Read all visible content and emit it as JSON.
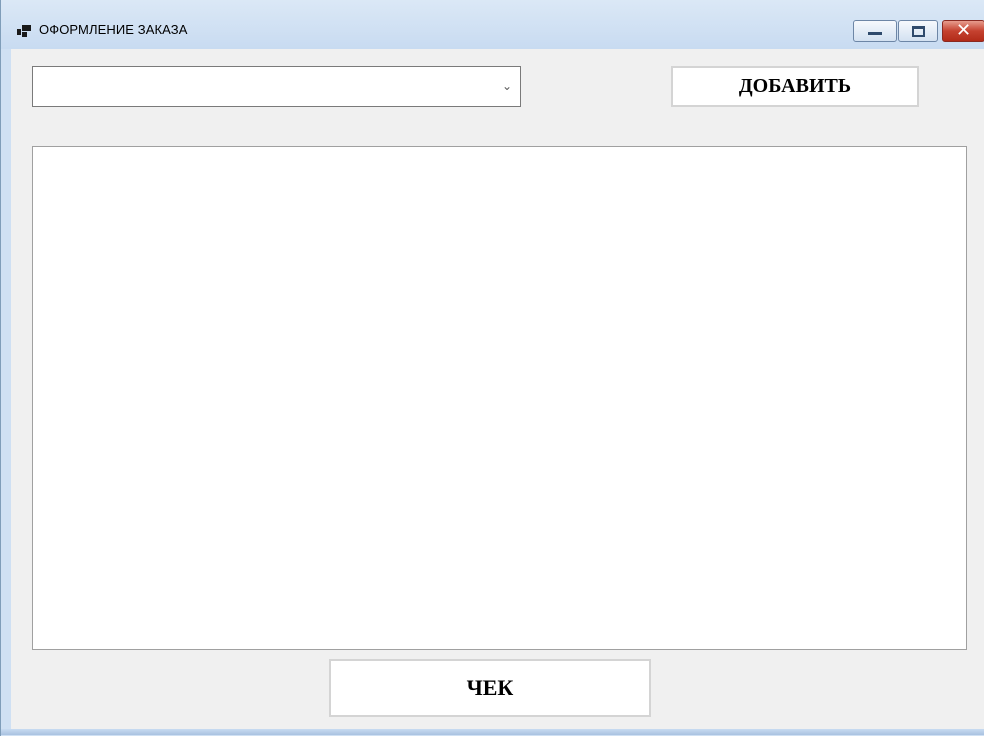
{
  "window": {
    "title": "ОФОРМЛЕНИЕ ЗАКАЗА",
    "app_icon": "app-icon",
    "controls": {
      "minimize_icon": "minimize-icon",
      "maximize_icon": "maximize-icon",
      "close_icon": "close-icon",
      "close_glyph": "✕"
    }
  },
  "form": {
    "product_combo": {
      "value": "",
      "arrow_glyph": "⌄"
    },
    "add_button_label": "ДОБАВИТЬ",
    "order_list": {
      "items": []
    },
    "check_button_label": "ЧЕК"
  },
  "colors": {
    "titlebar": "#c8dbf1",
    "client_background": "#f0f0f0",
    "close_button": "#c5412f"
  }
}
